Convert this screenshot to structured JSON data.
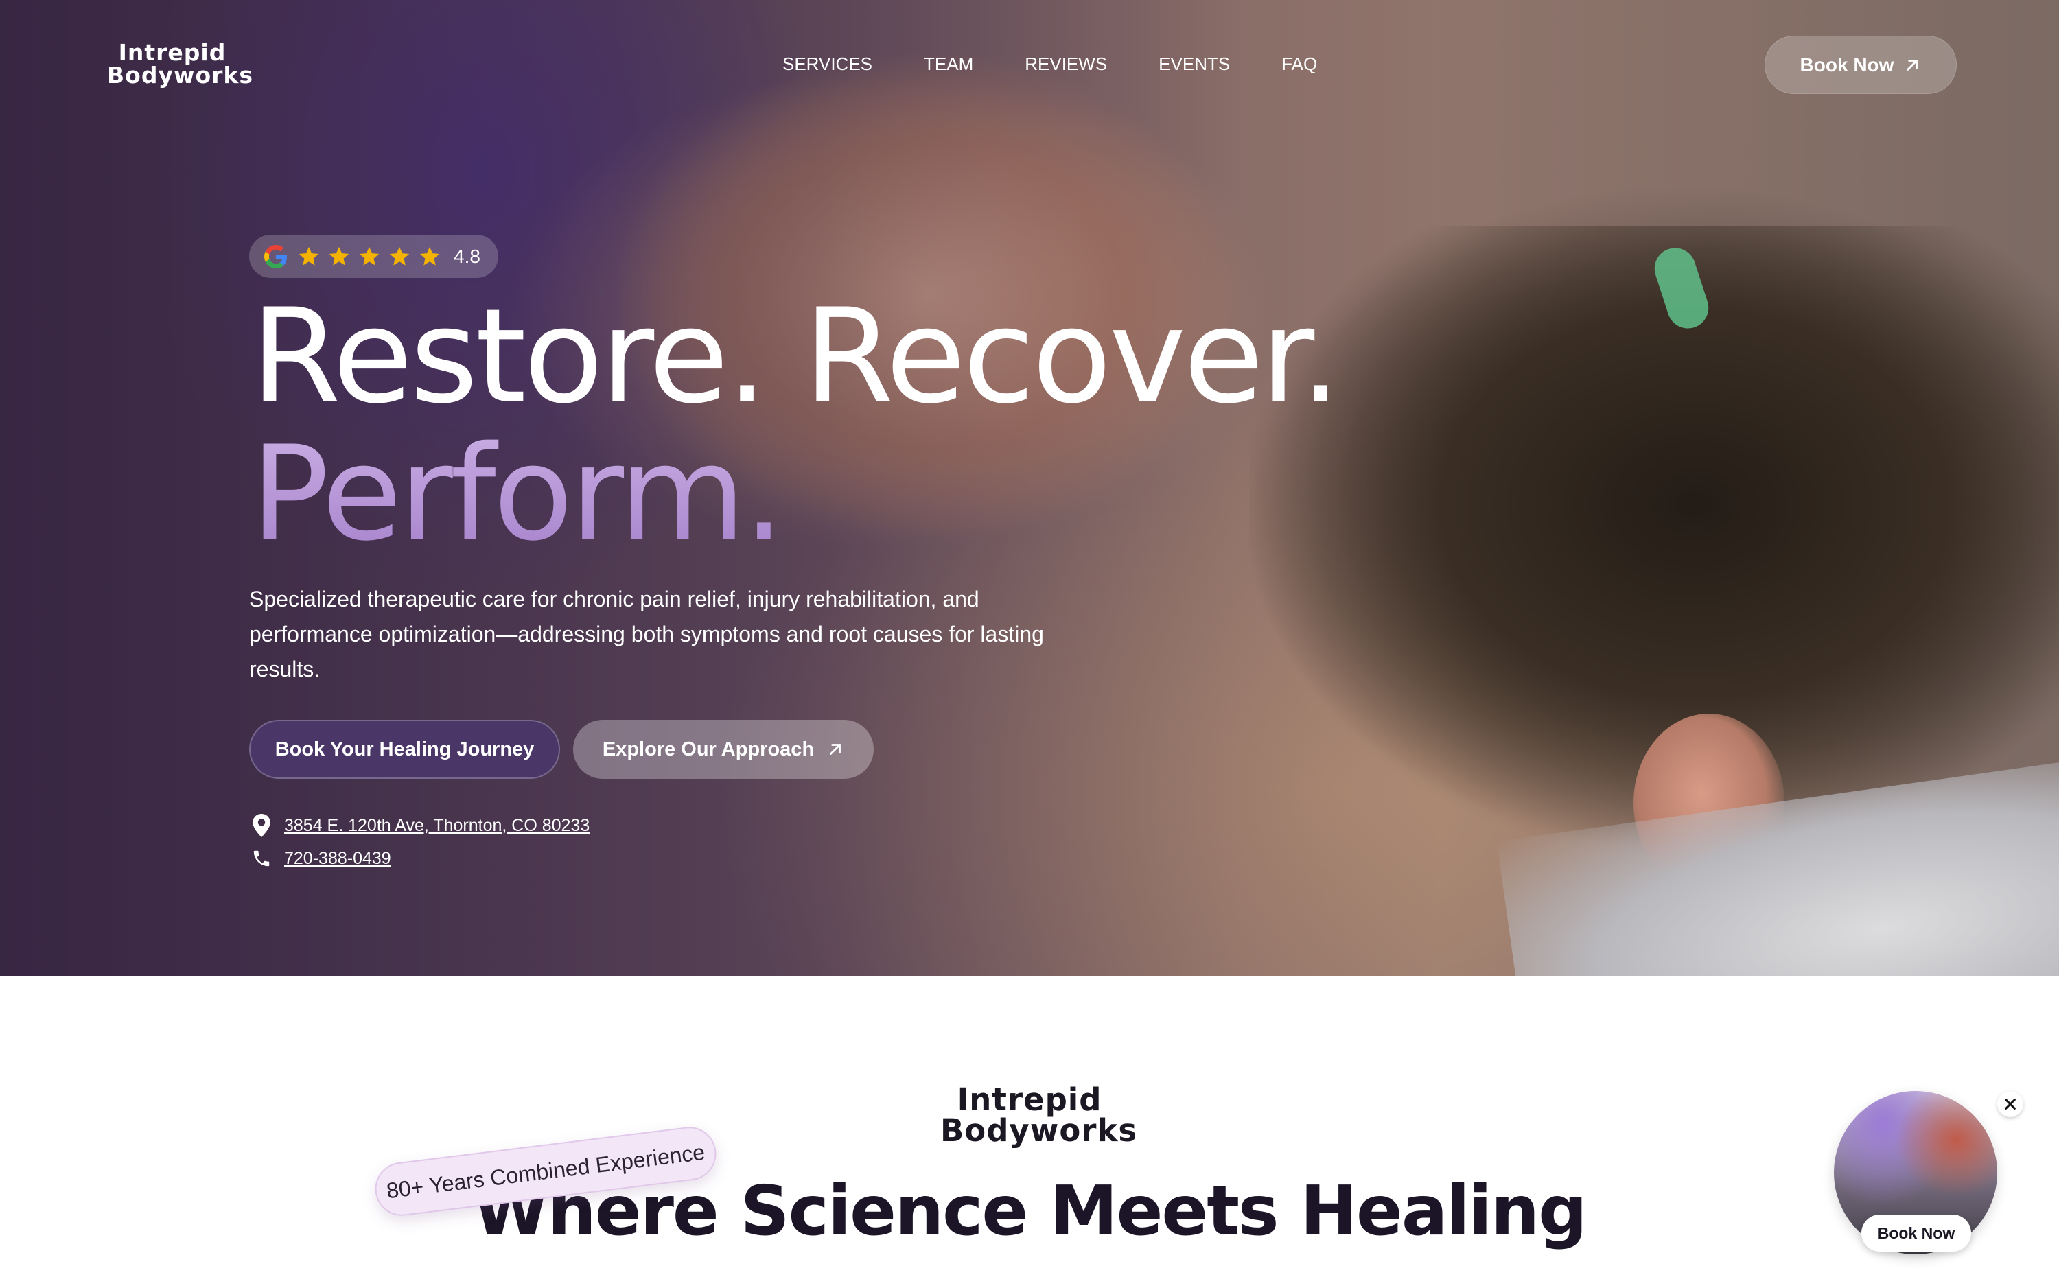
{
  "brand": {
    "logo_line1": "Intrepid",
    "logo_line2": "Bodyworks"
  },
  "nav": {
    "items": [
      "SERVICES",
      "TEAM",
      "REVIEWS",
      "EVENTS",
      "FAQ"
    ],
    "book_label": "Book Now"
  },
  "rating": {
    "value": "4.8",
    "stars": 5,
    "source_icon": "google-icon"
  },
  "hero": {
    "headline_line1": "Restore. Recover.",
    "headline_line2": "Perform.",
    "lead": "Specialized therapeutic care for chronic pain relief, injury rehabilitation, and performance optimization—addressing both symptoms and root causes for lasting results.",
    "primary_cta": "Book Your Healing Journey",
    "secondary_cta": "Explore Our Approach",
    "address": "3854 E. 120th Ave, Thornton, CO 80233",
    "phone": "720-388-0439"
  },
  "section": {
    "experience_badge": "80+ Years Combined Experience",
    "title": "Where Science Meets Healing"
  },
  "float_widget": {
    "book_label": "Book Now"
  },
  "colors": {
    "accent_purple": "#4a3768",
    "headline_gradient": "#b592d6",
    "star_yellow": "#f5b301",
    "title_ink": "#1b1527"
  }
}
